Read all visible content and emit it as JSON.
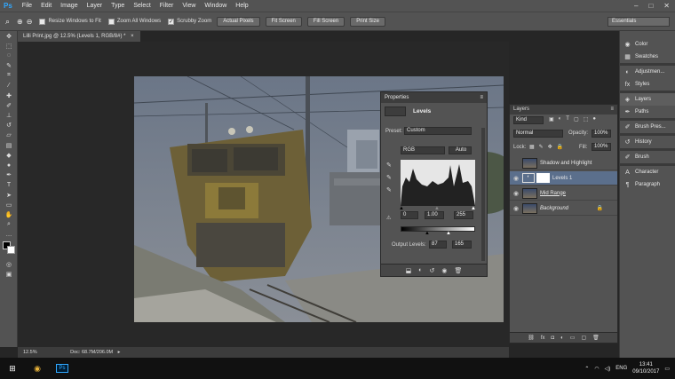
{
  "menubar": {
    "logo": "Ps",
    "items": [
      "File",
      "Edit",
      "Image",
      "Layer",
      "Type",
      "Select",
      "Filter",
      "View",
      "Window",
      "Help"
    ],
    "controls": [
      "–",
      "□",
      "✕"
    ]
  },
  "options": {
    "checks": [
      {
        "label": "Resize Windows to Fit",
        "checked": false
      },
      {
        "label": "Zoom All Windows",
        "checked": false
      },
      {
        "label": "Scrubby Zoom",
        "checked": true
      }
    ],
    "buttons": [
      "Actual Pixels",
      "Fit Screen",
      "Fill Screen",
      "Print Size"
    ],
    "workspace": "Essentials"
  },
  "document": {
    "tab": "Lilli Print.jpg @ 12.5% (Levels 1, RGB/8#) *",
    "zoom": "12.5%",
    "doc_info": "Doc: 68.7M/206.0M"
  },
  "properties": {
    "title": "Properties",
    "panel_name": "Levels",
    "preset_label": "Preset:",
    "preset_value": "Custom",
    "channel": "RGB",
    "auto": "Auto",
    "input_black": "0",
    "input_gamma": "1.00",
    "input_white": "255",
    "output_label": "Output Levels:",
    "output_black": "87",
    "output_white": "165"
  },
  "strip": {
    "items": [
      "Color",
      "Swatches",
      "Adjustmen...",
      "Styles",
      "Layers",
      "Paths",
      "Brush Pres...",
      "History",
      "Brush",
      "Character",
      "Paragraph"
    ]
  },
  "layers": {
    "title": "Layers",
    "filter": "Kind",
    "blend": "Normal",
    "opacity_label": "Opacity:",
    "opacity": "100%",
    "lock_label": "Lock:",
    "fill_label": "Fill:",
    "fill": "100%",
    "rows": [
      {
        "name": "Shadow and Highlight"
      },
      {
        "name": "Levels 1"
      },
      {
        "name": "Mid Range"
      },
      {
        "name": "Background"
      }
    ]
  },
  "taskbar": {
    "lang": "ENG",
    "time": "13:41",
    "date": "09/10/2017"
  },
  "colors": {
    "accent": "#31a8ff",
    "panel": "#535353",
    "canvas": "#282828"
  }
}
